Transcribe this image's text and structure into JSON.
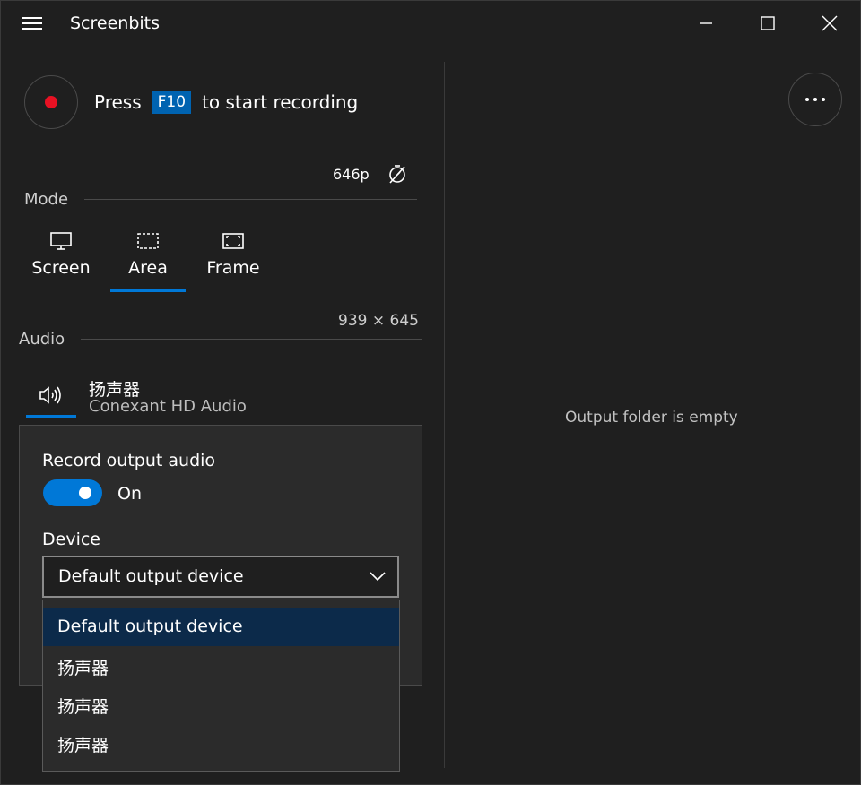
{
  "window": {
    "title": "Screenbits",
    "menu_icon": "hamburger-icon",
    "minimize_icon": "minimize-icon",
    "maximize_icon": "maximize-icon",
    "close_icon": "close-icon"
  },
  "recording": {
    "press_label": "Press",
    "hotkey": "F10",
    "start_label": "to start recording",
    "record_color": "#e81123"
  },
  "capture": {
    "fps": "646p",
    "timer_icon": "timer-off-icon"
  },
  "mode": {
    "section_label": "Mode",
    "items": [
      {
        "label": "Screen",
        "icon": "monitor-icon"
      },
      {
        "label": "Area",
        "icon": "area-select-icon"
      },
      {
        "label": "Frame",
        "icon": "frame-icon"
      }
    ],
    "selected": "Area",
    "size": "939 × 645"
  },
  "audio": {
    "section_label": "Audio",
    "icon": "speaker-icon",
    "name": "扬声器",
    "device": "Conexant HD Audio"
  },
  "flyout": {
    "title": "Record output audio",
    "toggle_state": "On",
    "toggle_on": true,
    "device_label": "Device",
    "selected_device": "Default output device",
    "options": [
      "Default output device",
      "扬声器",
      "扬声器",
      "扬声器"
    ]
  },
  "output": {
    "empty_text": "Output folder is empty",
    "more_icon": "more-icon"
  },
  "colors": {
    "accent": "#0078d7",
    "background": "#1f1f1f",
    "flyout": "#2b2b2b",
    "selected_item": "#0c2a4a"
  }
}
